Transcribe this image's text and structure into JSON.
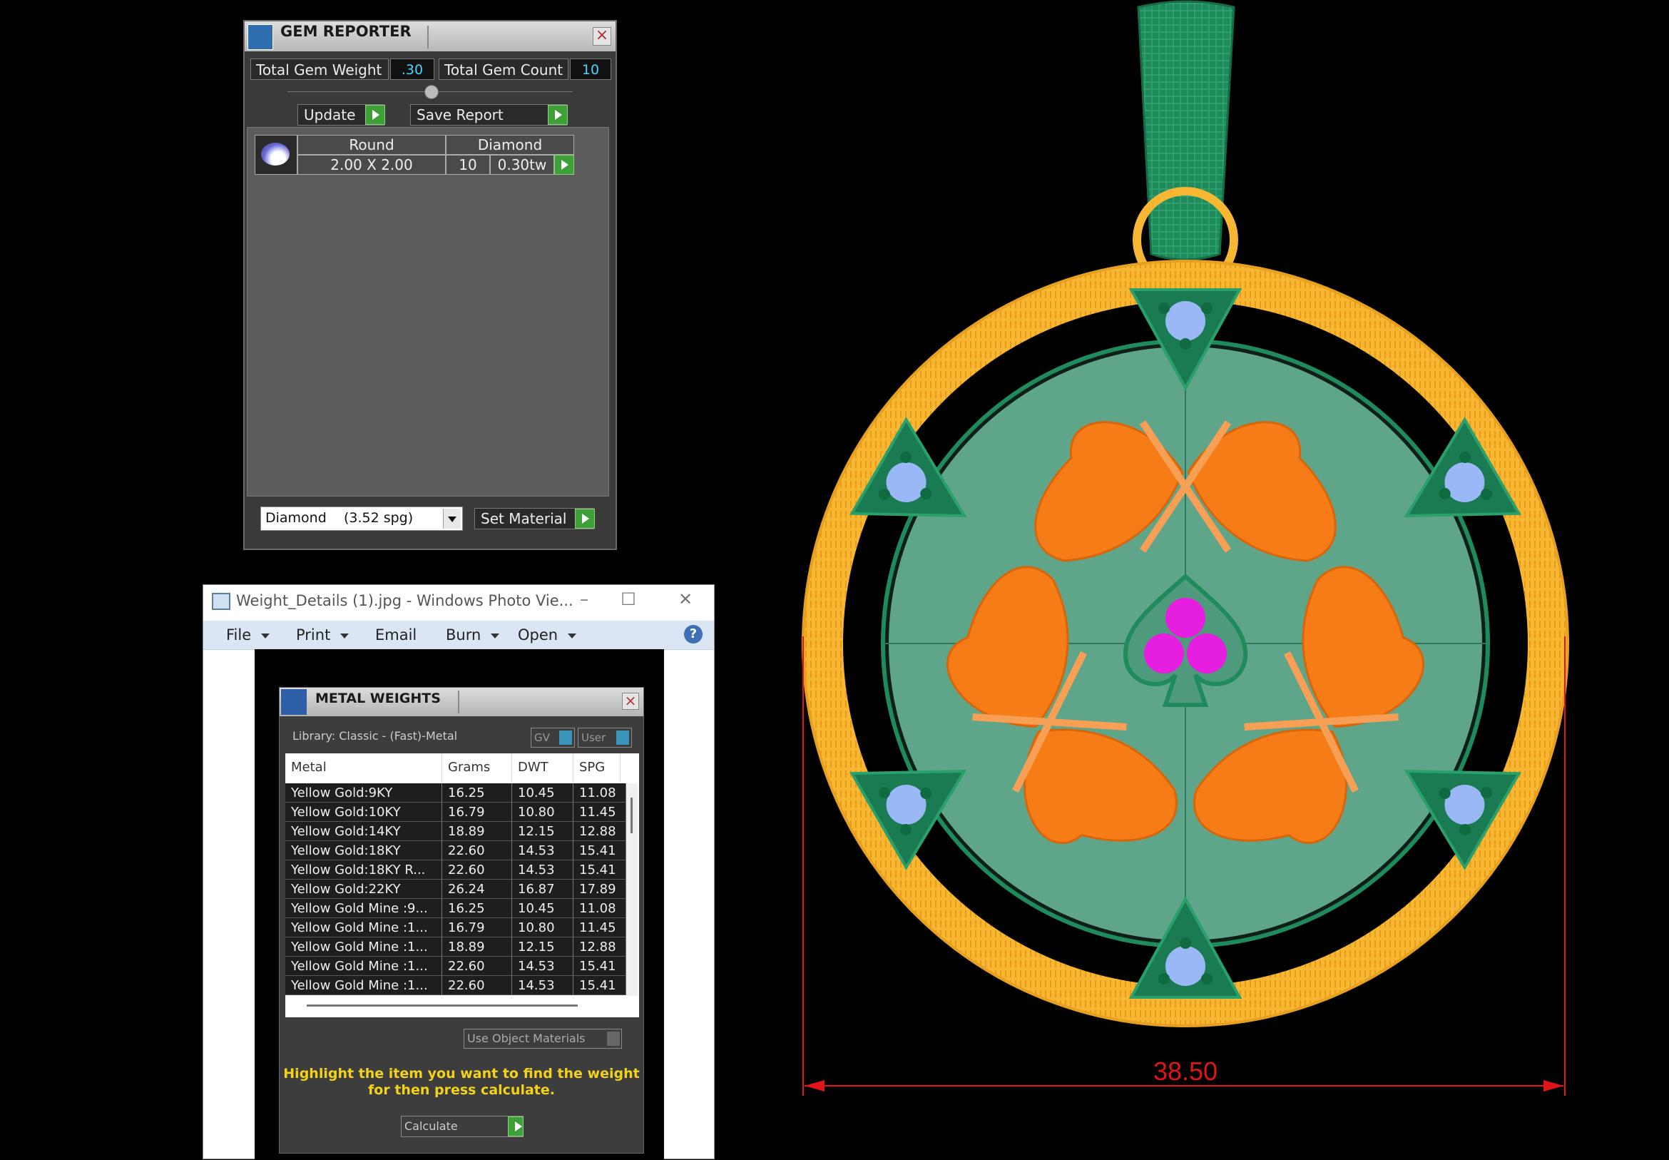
{
  "gem_reporter": {
    "title": "GEM REPORTER",
    "total_weight_label": "Total Gem Weight",
    "total_weight_value": ".30",
    "total_count_label": "Total Gem Count",
    "total_count_value": "10",
    "update_label": "Update",
    "save_report_label": "Save Report",
    "gem_row": {
      "shape": "Round",
      "material": "Diamond",
      "size": "2.00 X 2.00",
      "count": "10",
      "weight": "0.30tw"
    },
    "material_select": "Diamond    (3.52 spg)",
    "set_material_label": "Set Material"
  },
  "photo_viewer": {
    "title": "Weight_Details (1).jpg - Windows Photo Vie...",
    "menu": [
      {
        "label": "File",
        "has_arrow": true
      },
      {
        "label": "Print",
        "has_arrow": true
      },
      {
        "label": "Email",
        "has_arrow": false
      },
      {
        "label": "Burn",
        "has_arrow": true
      },
      {
        "label": "Open",
        "has_arrow": true
      }
    ],
    "help_icon": "?"
  },
  "metal_weights": {
    "title": "METAL WEIGHTS",
    "library": "Library: Classic - (Fast)-Metal",
    "toggle_gv": "GV",
    "toggle_user": "User",
    "columns": [
      "Metal",
      "Grams",
      "DWT",
      "SPG"
    ],
    "rows": [
      [
        "Yellow Gold:9KY",
        "16.25",
        "10.45",
        "11.08"
      ],
      [
        "Yellow Gold:10KY",
        "16.79",
        "10.80",
        "11.45"
      ],
      [
        "Yellow Gold:14KY",
        "18.89",
        "12.15",
        "12.88"
      ],
      [
        "Yellow Gold:18KY",
        "22.60",
        "14.53",
        "15.41"
      ],
      [
        "Yellow Gold:18KY R...",
        "22.60",
        "14.53",
        "15.41"
      ],
      [
        "Yellow Gold:22KY",
        "26.24",
        "16.87",
        "17.89"
      ],
      [
        "Yellow Gold Mine :9...",
        "16.25",
        "10.45",
        "11.08"
      ],
      [
        "Yellow Gold Mine :1...",
        "16.79",
        "10.80",
        "11.45"
      ],
      [
        "Yellow Gold Mine :1...",
        "18.89",
        "12.15",
        "12.88"
      ],
      [
        "Yellow Gold Mine :1...",
        "22.60",
        "14.53",
        "15.41"
      ],
      [
        "Yellow Gold Mine :1...",
        "22.60",
        "14.53",
        "15.41"
      ]
    ],
    "use_object_materials": "Use Object Materials",
    "hint_line1": "Highlight the item you want to find the weight",
    "hint_line2": "for then press calculate.",
    "calculate_label": "Calculate"
  },
  "pendant": {
    "dimension_label": "38.50",
    "colors": {
      "gold": "#f7b733",
      "green": "#1f8a5c",
      "face": "#5fa58a",
      "leaf": "#f57c16",
      "stone_blue": "#9ab8f5",
      "stone_pink": "#e61ee0",
      "dimension": "#e01515"
    }
  }
}
